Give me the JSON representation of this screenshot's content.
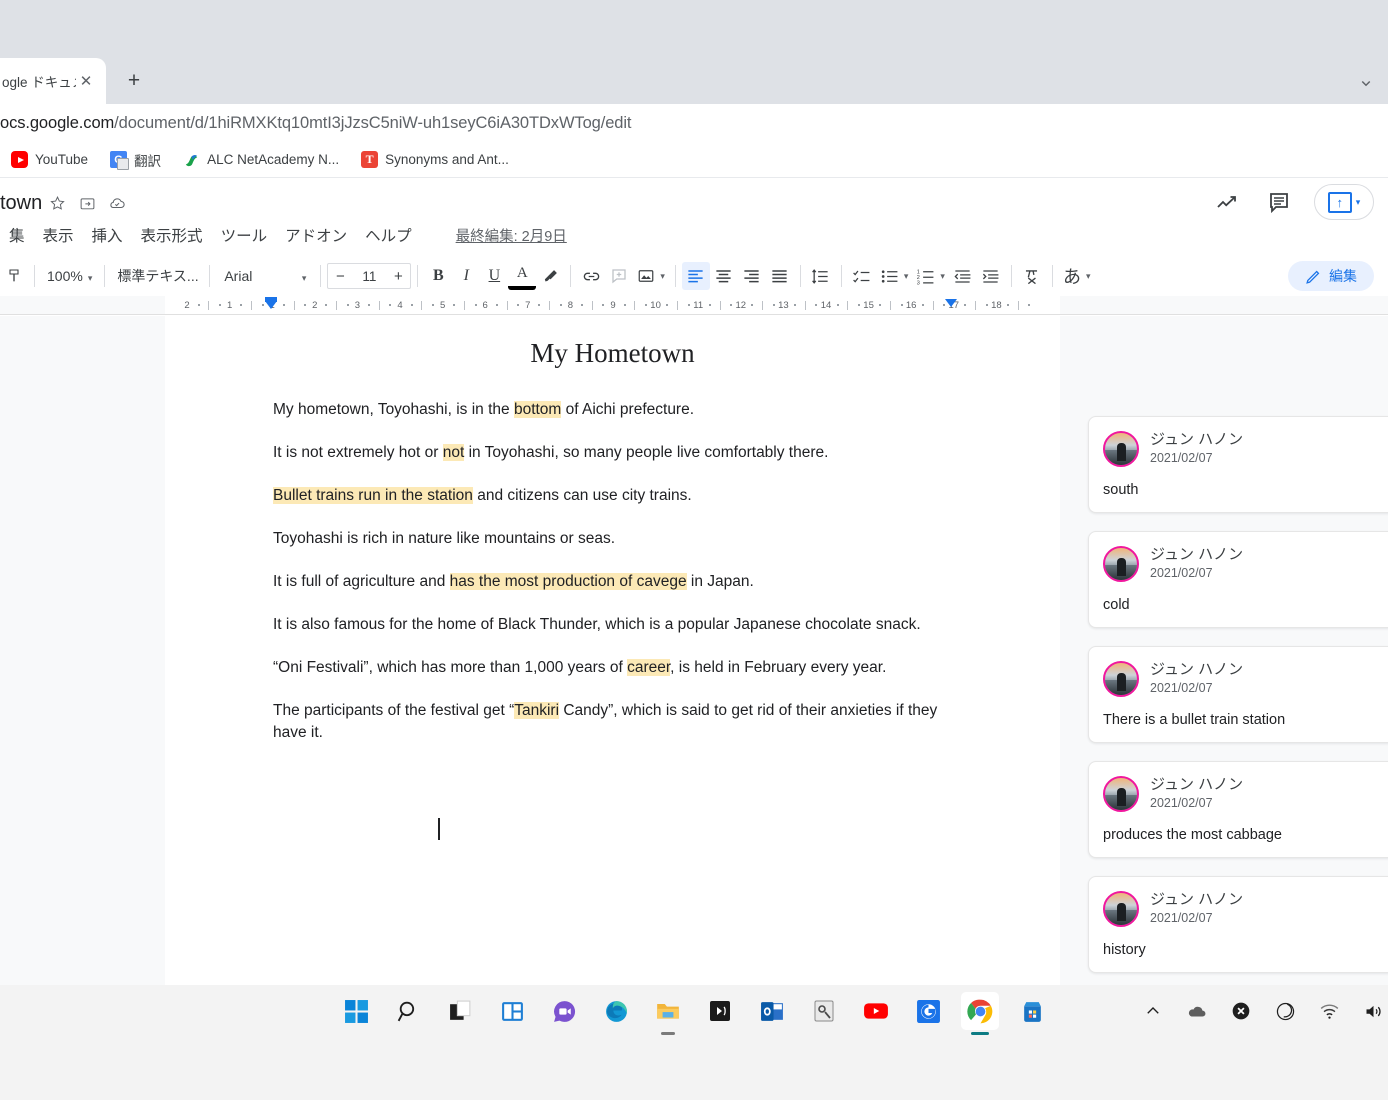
{
  "browser": {
    "tab": {
      "title": "ogle ドキュメン",
      "close_label": "✕"
    },
    "newtab_label": "+",
    "url": "ocs.google.com/document/d/1hiRMXKtq10mtI3jJzsC5niW-uh1seyC6iA30TDxWTog/edit",
    "url_domain": "ocs.google.com",
    "url_path": "/document/d/1hiRMXKtq10mtI3jJzsC5niW-uh1seyC6iA30TDxWTog/edit",
    "bookmarks": [
      {
        "label": "YouTube",
        "icon": "youtube-icon"
      },
      {
        "label": "翻訳",
        "icon": "google-translate-icon"
      },
      {
        "label": "ALC NetAcademy N...",
        "icon": "alc-icon"
      },
      {
        "label": "Synonyms and Ant...",
        "icon": "thesaurus-icon"
      }
    ]
  },
  "docs": {
    "title": "town",
    "title_icons": [
      "star-icon",
      "move-to-folder-icon",
      "cloud-saved-icon"
    ],
    "menus": [
      "集",
      "表示",
      "挿入",
      "表示形式",
      "ツール",
      "アドオン",
      "ヘルプ"
    ],
    "last_edit": "最終編集: 2月9日",
    "header_icons": [
      "activity-trend-icon",
      "comment-history-icon"
    ],
    "share_button": {
      "label": "",
      "caret": "▾"
    },
    "toolbar": {
      "zoom": "100%",
      "style": "標準テキス...",
      "font": "Arial",
      "font_size": "11",
      "minus": "−",
      "plus": "+",
      "bold": "B",
      "italic": "I",
      "underline": "U",
      "text_color": "A",
      "caret": "▾",
      "lang_label": "あ",
      "edit_mode_label": "編集"
    },
    "ruler": {
      "labels": [
        "2",
        "1",
        "1",
        "2",
        "3",
        "4",
        "5",
        "6",
        "7",
        "8",
        "9",
        "10",
        "11",
        "12",
        "13",
        "14",
        "15",
        "16",
        "17",
        "18"
      ]
    }
  },
  "document": {
    "heading": "My Hometown",
    "paragraphs": [
      {
        "runs": [
          {
            "t": "My hometown, Toyohashi, is in the ",
            "hl": false
          },
          {
            "t": "bottom",
            "hl": true
          },
          {
            "t": " of Aichi prefecture.",
            "hl": false
          }
        ]
      },
      {
        "runs": [
          {
            "t": "It is not extremely hot or ",
            "hl": false
          },
          {
            "t": "not",
            "hl": true
          },
          {
            "t": " in Toyohashi, so many people live comfortably there.",
            "hl": false
          }
        ]
      },
      {
        "runs": [
          {
            "t": "Bullet trains run in the station",
            "hl": true
          },
          {
            "t": " and citizens can use city trains.",
            "hl": false
          }
        ]
      },
      {
        "runs": [
          {
            "t": "Toyohashi is rich in nature like mountains or seas.",
            "hl": false
          }
        ]
      },
      {
        "runs": [
          {
            "t": "It is full of agriculture and ",
            "hl": false
          },
          {
            "t": "has the most production of cavege",
            "hl": true
          },
          {
            "t": " in Japan.",
            "hl": false
          }
        ]
      },
      {
        "runs": [
          {
            "t": "It is also famous for the home of Black Thunder, which is a popular Japanese chocolate snack.",
            "hl": false
          }
        ]
      },
      {
        "runs": [
          {
            "t": "“Oni Festivali”, which has more than 1,000 years of ",
            "hl": false
          },
          {
            "t": "career",
            "hl": true
          },
          {
            "t": ", is held in February every year.",
            "hl": false
          }
        ]
      },
      {
        "runs": [
          {
            "t": "The participants of the festival get “",
            "hl": false
          },
          {
            "t": "Tankiri",
            "hl": true
          },
          {
            "t": " Candy”, which is said to get rid of their anxieties if they have it.",
            "hl": false
          }
        ]
      }
    ]
  },
  "comments": [
    {
      "author": "ジュン ハノン",
      "date": "2021/02/07",
      "text": "south"
    },
    {
      "author": "ジュン ハノン",
      "date": "2021/02/07",
      "text": "cold"
    },
    {
      "author": "ジュン ハノン",
      "date": "2021/02/07",
      "text": "There is a bullet train station"
    },
    {
      "author": "ジュン ハノン",
      "date": "2021/02/07",
      "text": "produces the most cabbage"
    },
    {
      "author": "ジュン ハノン",
      "date": "2021/02/07",
      "text": "history"
    }
  ],
  "taskbar": {
    "items": [
      {
        "name": "start-icon"
      },
      {
        "name": "search-icon"
      },
      {
        "name": "task-view-icon"
      },
      {
        "name": "widgets-icon"
      },
      {
        "name": "chat-icon"
      },
      {
        "name": "edge-icon"
      },
      {
        "name": "file-explorer-icon"
      },
      {
        "name": "media-player-icon"
      },
      {
        "name": "outlook-icon"
      },
      {
        "name": "settings-photo-icon"
      },
      {
        "name": "youtube-icon"
      },
      {
        "name": "google-icon"
      },
      {
        "name": "chrome-icon"
      },
      {
        "name": "microsoft-store-icon"
      }
    ],
    "tray": [
      {
        "name": "show-hidden-icons-icon"
      },
      {
        "name": "onedrive-icon"
      },
      {
        "name": "error-badge-icon"
      },
      {
        "name": "moon-dnd-icon"
      },
      {
        "name": "wifi-icon"
      },
      {
        "name": "volume-icon"
      }
    ]
  },
  "colors": {
    "accent_blue": "#1a73e8",
    "highlight_yellow": "#fce9b6",
    "chrome_gray": "#dee1e6",
    "canvas_gray": "#f8f9fa",
    "avatar_ring": "#f0179e"
  }
}
